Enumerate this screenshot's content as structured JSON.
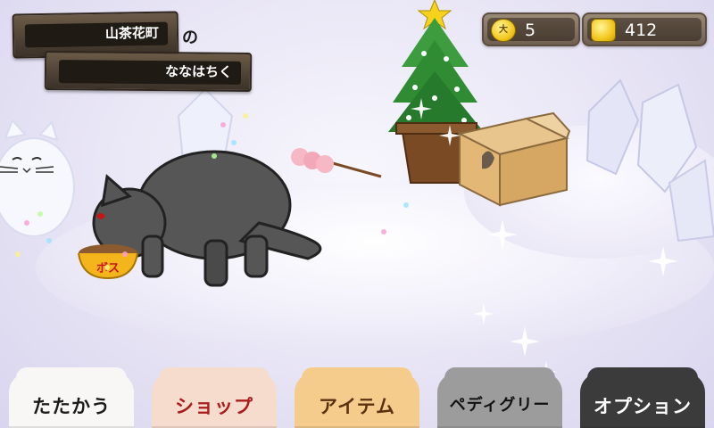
{
  "location": {
    "town": "山茶花町",
    "particle": "の",
    "district": "ななはちく"
  },
  "currency": {
    "tickets": "5",
    "ticket_coin_text": "大",
    "coins": "412"
  },
  "tabs": [
    {
      "label": "たたかう",
      "bg": "#f8f7f6",
      "fg": "#1a1a1a"
    },
    {
      "label": "ショップ",
      "bg": "#f6dccc",
      "fg": "#a81c1c"
    },
    {
      "label": "アイテム",
      "bg": "#f5cc8c",
      "fg": "#5a3210"
    },
    {
      "label": "ペディグリー",
      "bg": "#9c9c9c",
      "fg": "#111111"
    },
    {
      "label": "オプション",
      "bg": "#3b3b3b",
      "fg": "#ffffff"
    }
  ],
  "food_bowl_text": "ボス"
}
